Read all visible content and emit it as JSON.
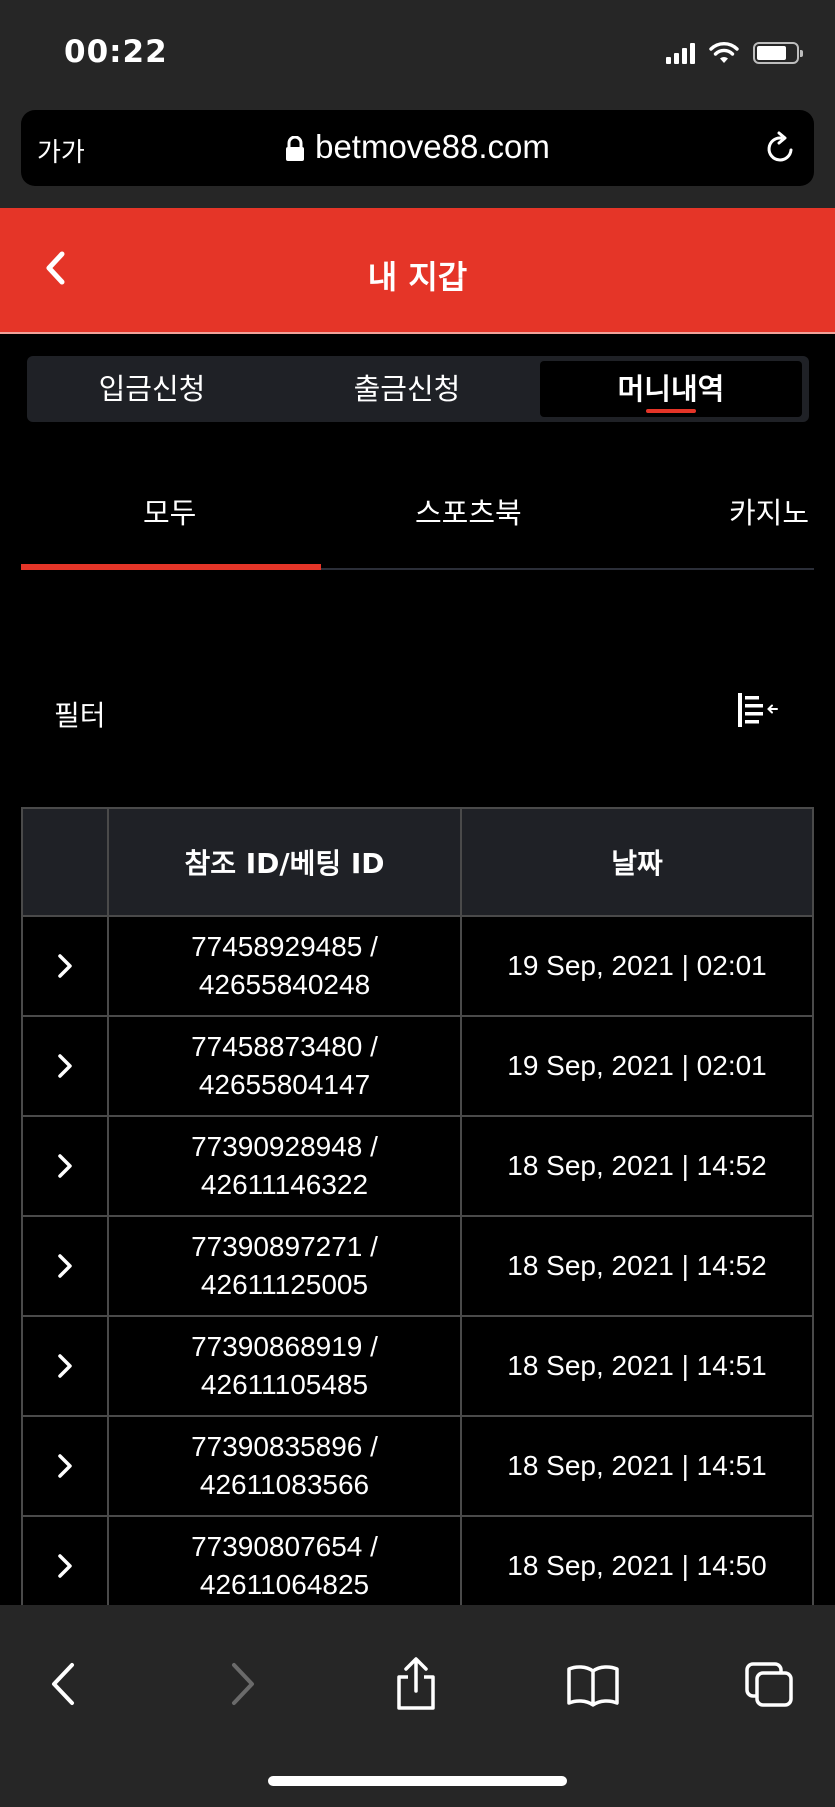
{
  "status": {
    "time": "00:22"
  },
  "browser": {
    "aa_label": "가가",
    "url": "betmove88.com"
  },
  "header": {
    "title": "내 지갑"
  },
  "segments": [
    {
      "label": "입금신청",
      "active": false
    },
    {
      "label": "출금신청",
      "active": false
    },
    {
      "label": "머니내역",
      "active": true
    }
  ],
  "categories": [
    {
      "label": "모두",
      "active": true
    },
    {
      "label": "스포츠북",
      "active": false
    },
    {
      "label": "카지노",
      "active": false
    }
  ],
  "filter": {
    "label": "필터",
    "icon": "filter-sort-icon"
  },
  "table": {
    "headers": {
      "ref": "참조 ID/베팅 ID",
      "date": "날짜"
    },
    "rows": [
      {
        "ref": "77458929485 /",
        "bet": "42655840248",
        "date": "19 Sep, 2021 | 02:01"
      },
      {
        "ref": "77458873480 /",
        "bet": "42655804147",
        "date": "19 Sep, 2021 | 02:01"
      },
      {
        "ref": "77390928948 /",
        "bet": "42611146322",
        "date": "18 Sep, 2021 | 14:52"
      },
      {
        "ref": "77390897271 /",
        "bet": "42611125005",
        "date": "18 Sep, 2021 | 14:52"
      },
      {
        "ref": "77390868919 /",
        "bet": "42611105485",
        "date": "18 Sep, 2021 | 14:51"
      },
      {
        "ref": "77390835896 /",
        "bet": "42611083566",
        "date": "18 Sep, 2021 | 14:51"
      },
      {
        "ref": "77390807654 /",
        "bet": "42611064825",
        "date": "18 Sep, 2021 | 14:50"
      }
    ]
  },
  "colors": {
    "accent": "#e53528",
    "chrome": "#262626",
    "background": "#000000",
    "panel": "#1f2126"
  }
}
